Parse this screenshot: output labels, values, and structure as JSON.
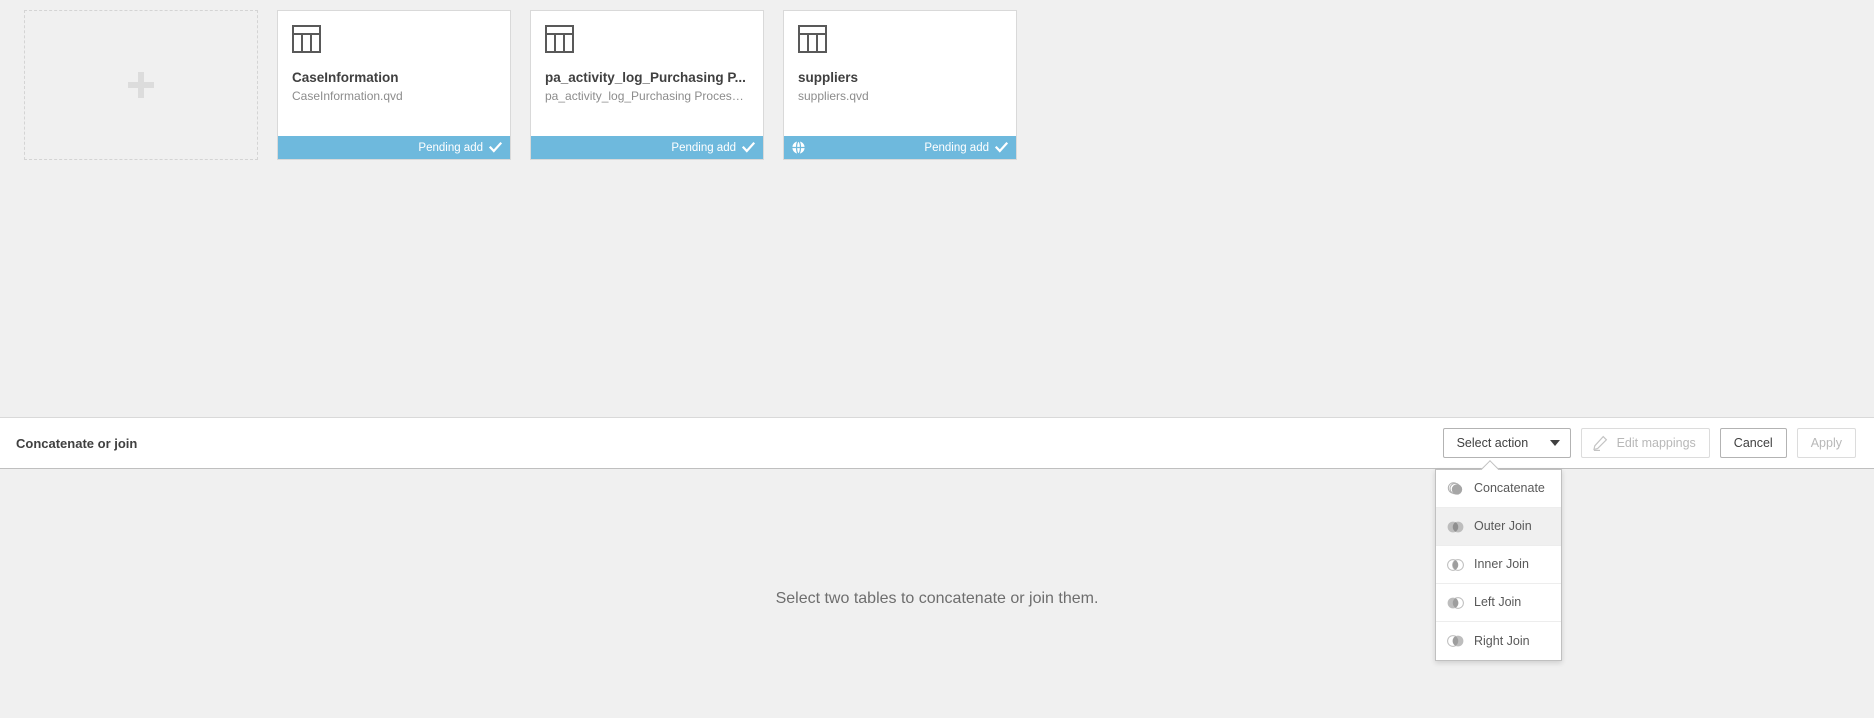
{
  "colors": {
    "accent": "#6eb9dd",
    "page_background": "#f0f0f0",
    "card_background": "#ffffff",
    "text_primary": "#404040",
    "text_secondary": "#8c8c8c"
  },
  "cards": {
    "add_card": {
      "icon": "plus-icon",
      "label": ""
    },
    "items": [
      {
        "icon": "table-icon",
        "title": "CaseInformation",
        "subtitle": "CaseInformation.qvd",
        "status": "Pending add",
        "status_icon": "check-icon",
        "source_icon": null
      },
      {
        "icon": "table-icon",
        "title": "pa_activity_log_Purchasing P...",
        "subtitle": "pa_activity_log_Purchasing Process....",
        "status": "Pending add",
        "status_icon": "check-icon",
        "source_icon": null
      },
      {
        "icon": "table-icon",
        "title": "suppliers",
        "subtitle": "suppliers.qvd",
        "status": "Pending add",
        "status_icon": "check-icon",
        "source_icon": "globe-icon"
      }
    ]
  },
  "action_bar": {
    "title": "Concatenate or join",
    "select_action": {
      "label": "Select action",
      "icon": "chevron-down-icon",
      "expanded": true
    },
    "edit_mappings": {
      "label": "Edit mappings",
      "icon": "pencil-icon",
      "disabled": true
    },
    "cancel": {
      "label": "Cancel",
      "disabled": false
    },
    "apply": {
      "label": "Apply",
      "disabled": true
    }
  },
  "dropdown": {
    "items": [
      {
        "label": "Concatenate",
        "icon": "concatenate-icon",
        "highlighted": false
      },
      {
        "label": "Outer Join",
        "icon": "outer-join-icon",
        "highlighted": true
      },
      {
        "label": "Inner Join",
        "icon": "inner-join-icon",
        "highlighted": false
      },
      {
        "label": "Left Join",
        "icon": "left-join-icon",
        "highlighted": false
      },
      {
        "label": "Right Join",
        "icon": "right-join-icon",
        "highlighted": false
      }
    ]
  },
  "canvas": {
    "empty_message": "Select two tables to concatenate or join them."
  }
}
